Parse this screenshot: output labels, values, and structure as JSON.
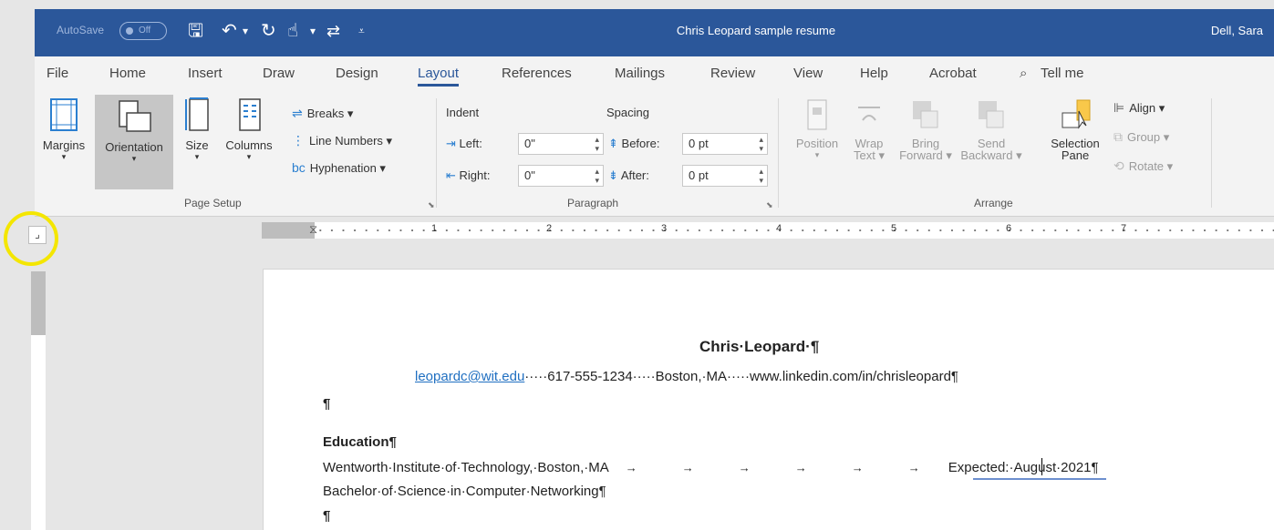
{
  "titlebar": {
    "autosave_label": "AutoSave",
    "autosave_state": "Off",
    "document_title": "Chris Leopard sample resume",
    "user": "Dell, Sara"
  },
  "tabs": [
    "File",
    "Home",
    "Insert",
    "Draw",
    "Design",
    "Layout",
    "References",
    "Mailings",
    "Review",
    "View",
    "Help",
    "Acrobat",
    "Tell me"
  ],
  "active_tab": "Layout",
  "ribbon": {
    "page_setup": {
      "margins": "Margins",
      "orientation": "Orientation",
      "size": "Size",
      "columns": "Columns",
      "breaks": "Breaks",
      "line_numbers": "Line Numbers",
      "hyphenation": "Hyphenation",
      "group_label": "Page Setup"
    },
    "paragraph": {
      "indent_label": "Indent",
      "spacing_label": "Spacing",
      "left_label": "Left:",
      "right_label": "Right:",
      "before_label": "Before:",
      "after_label": "After:",
      "left_value": "0\"",
      "right_value": "0\"",
      "before_value": "0 pt",
      "after_value": "0 pt",
      "group_label": "Paragraph"
    },
    "arrange": {
      "position": "Position",
      "wrap_text_1": "Wrap",
      "wrap_text_2": "Text",
      "bring_forward_1": "Bring",
      "bring_forward_2": "Forward",
      "send_backward_1": "Send",
      "send_backward_2": "Backward",
      "selection_pane_1": "Selection",
      "selection_pane_2": "Pane",
      "align": "Align",
      "group": "Group",
      "rotate": "Rotate",
      "group_label": "Arrange"
    }
  },
  "ruler": {
    "numbers": [
      "1",
      "2",
      "3",
      "4",
      "5",
      "6",
      "7"
    ]
  },
  "document": {
    "name": "Chris·Leopard·¶",
    "email": "leopardc@wit.edu",
    "contact_rest": "·····617-555-1234·····Boston,·MA·····www.linkedin.com/in/chrisleopard¶",
    "blank1": "¶",
    "education_heading": "Education¶",
    "school": "Wentworth·Institute·of·Technology,·Boston,·MA",
    "expected": "Expected:·August·2021¶",
    "degree": "Bachelor·of·Science·in·Computer·Networking¶",
    "blank2": "¶"
  }
}
